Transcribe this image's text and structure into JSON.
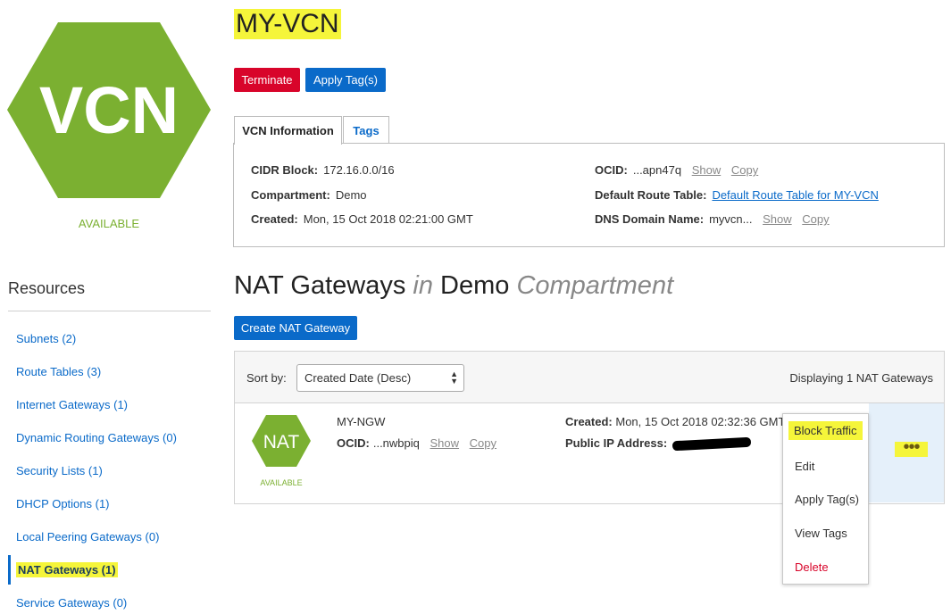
{
  "vcn_logo": {
    "text": "VCN",
    "status": "AVAILABLE",
    "color": "#7bb031"
  },
  "header": {
    "title": "MY-VCN"
  },
  "actions": {
    "terminate": "Terminate",
    "apply_tags": "Apply Tag(s)"
  },
  "tabs": {
    "vcn_info": "VCN Information",
    "tags": "Tags"
  },
  "info": {
    "cidr_label": "CIDR Block:",
    "cidr_value": "172.16.0.0/16",
    "compartment_label": "Compartment:",
    "compartment_value": "Demo",
    "created_label": "Created:",
    "created_value": "Mon, 15 Oct 2018 02:21:00 GMT",
    "ocid_label": "OCID:",
    "ocid_value": "...apn47q",
    "route_label": "Default Route Table:",
    "route_value": "Default Route Table for MY-VCN",
    "dns_label": "DNS Domain Name:",
    "dns_value": "myvcn...",
    "show": "Show",
    "copy": "Copy"
  },
  "resources": {
    "title": "Resources",
    "items": [
      "Subnets (2)",
      "Route Tables (3)",
      "Internet Gateways (1)",
      "Dynamic Routing Gateways (0)",
      "Security Lists (1)",
      "DHCP Options (1)",
      "Local Peering Gateways (0)",
      "NAT Gateways (1)",
      "Service Gateways (0)"
    ],
    "active_index": 7
  },
  "section": {
    "title": "NAT Gateways",
    "in": "in",
    "compartment": "Demo",
    "suffix": "Compartment"
  },
  "create_button": "Create NAT Gateway",
  "list": {
    "sort_label": "Sort by:",
    "sort_value": "Created Date (Desc)",
    "displaying": "Displaying 1 NAT Gateways"
  },
  "nat": {
    "logo_text": "NAT",
    "status": "AVAILABLE",
    "name": "MY-NGW",
    "ocid_label": "OCID:",
    "ocid_value": "...nwbpiq",
    "show": "Show",
    "copy": "Copy",
    "created_label": "Created:",
    "created_value": "Mon, 15 Oct 2018 02:32:36 GMT",
    "ip_label": "Public IP Address:"
  },
  "menu": {
    "block_traffic": "Block Traffic",
    "edit": "Edit",
    "apply_tags": "Apply Tag(s)",
    "view_tags": "View Tags",
    "delete": "Delete"
  },
  "colors": {
    "accent": "#0a6ac9",
    "danger": "#d8042a",
    "available": "#7bb031",
    "highlight": "#f5f53a"
  }
}
